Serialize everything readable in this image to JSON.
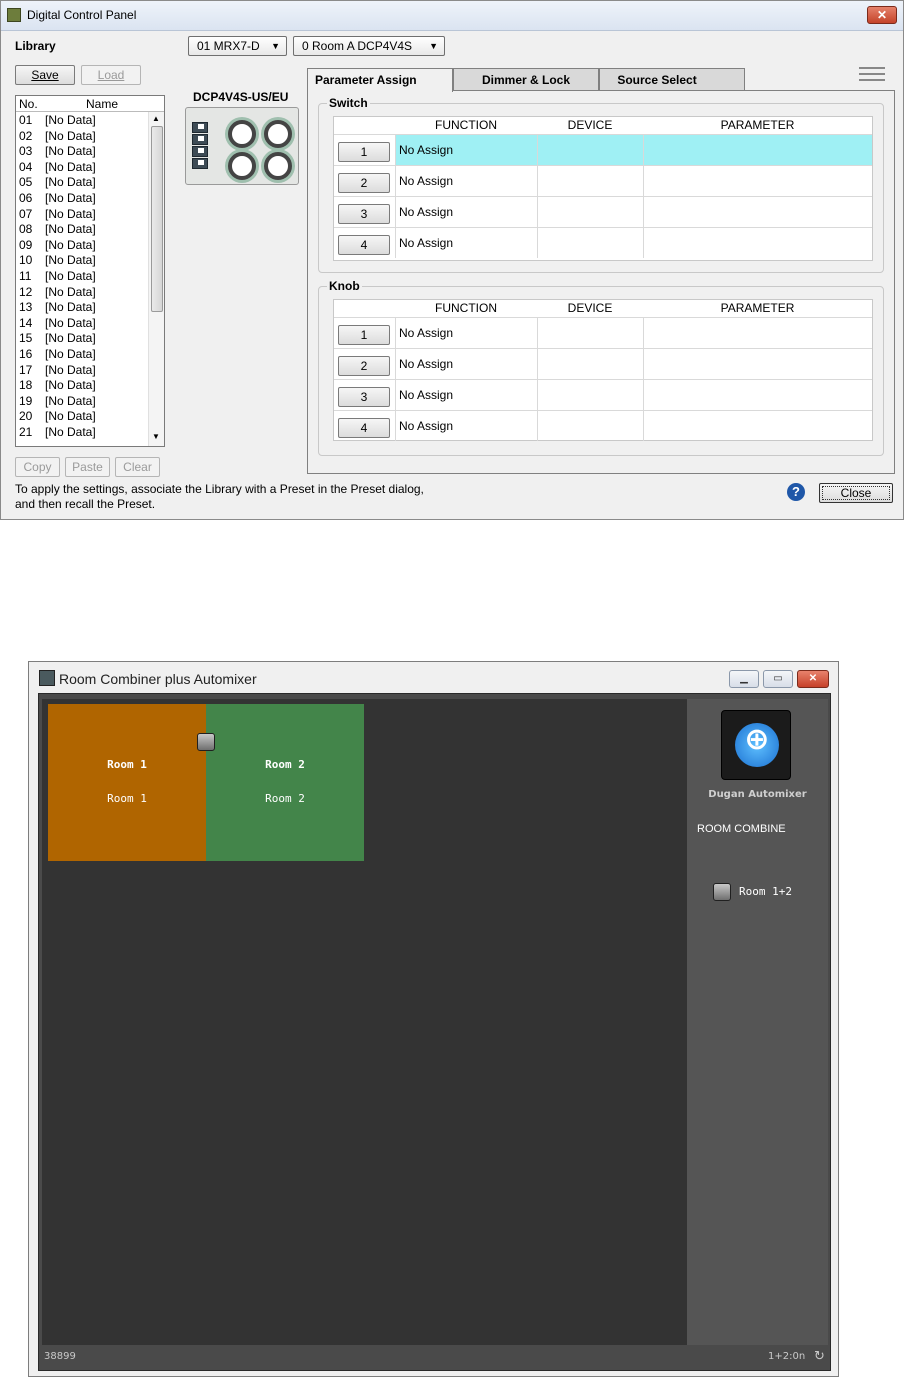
{
  "dcp": {
    "title": "Digital Control Panel",
    "close_glyph": "✕",
    "library_label": "Library",
    "save_label": "Save",
    "load_label": "Load",
    "device_select": "01 MRX7-D",
    "preset_select": "0 Room A DCP4V4S",
    "device_model": "DCP4V4S-US/EU",
    "list_header": {
      "no": "No.",
      "name": "Name"
    },
    "library_items": [
      {
        "no": "01",
        "name": "[No Data]"
      },
      {
        "no": "02",
        "name": "[No Data]"
      },
      {
        "no": "03",
        "name": "[No Data]"
      },
      {
        "no": "04",
        "name": "[No Data]"
      },
      {
        "no": "05",
        "name": "[No Data]"
      },
      {
        "no": "06",
        "name": "[No Data]"
      },
      {
        "no": "07",
        "name": "[No Data]"
      },
      {
        "no": "08",
        "name": "[No Data]"
      },
      {
        "no": "09",
        "name": "[No Data]"
      },
      {
        "no": "10",
        "name": "[No Data]"
      },
      {
        "no": "11",
        "name": "[No Data]"
      },
      {
        "no": "12",
        "name": "[No Data]"
      },
      {
        "no": "13",
        "name": "[No Data]"
      },
      {
        "no": "14",
        "name": "[No Data]"
      },
      {
        "no": "15",
        "name": "[No Data]"
      },
      {
        "no": "16",
        "name": "[No Data]"
      },
      {
        "no": "17",
        "name": "[No Data]"
      },
      {
        "no": "18",
        "name": "[No Data]"
      },
      {
        "no": "19",
        "name": "[No Data]"
      },
      {
        "no": "20",
        "name": "[No Data]"
      },
      {
        "no": "21",
        "name": "[No Data]"
      }
    ],
    "copy_label": "Copy",
    "paste_label": "Paste",
    "clear_label": "Clear",
    "tabs": [
      "Parameter Assign",
      "Dimmer & Lock",
      "Source Select"
    ],
    "switch_group": "Switch",
    "knob_group": "Knob",
    "columns": {
      "function": "FUNCTION",
      "device": "DEVICE",
      "parameter": "PARAMETER"
    },
    "switch_rows": [
      {
        "num": "1",
        "function": "No Assign",
        "device": "",
        "parameter": ""
      },
      {
        "num": "2",
        "function": "No Assign",
        "device": "",
        "parameter": ""
      },
      {
        "num": "3",
        "function": "No Assign",
        "device": "",
        "parameter": ""
      },
      {
        "num": "4",
        "function": "No Assign",
        "device": "",
        "parameter": ""
      }
    ],
    "knob_rows": [
      {
        "num": "1",
        "function": "No Assign",
        "device": "",
        "parameter": ""
      },
      {
        "num": "2",
        "function": "No Assign",
        "device": "",
        "parameter": ""
      },
      {
        "num": "3",
        "function": "No Assign",
        "device": "",
        "parameter": ""
      },
      {
        "num": "4",
        "function": "No Assign",
        "device": "",
        "parameter": ""
      }
    ],
    "footer_line1": "To apply the settings, associate the Library with a Preset in the Preset dialog,",
    "footer_line2": "and then recall the Preset.",
    "help_glyph": "?",
    "close_label": "Close",
    "selection_color": "#9ff0f4"
  },
  "rc": {
    "title": "Room Combiner plus Automixer",
    "rooms": [
      {
        "name": "Room 1",
        "subtitle": "Room 1",
        "color": "#b06500"
      },
      {
        "name": "Room 2",
        "subtitle": "Room 2",
        "color": "#43854a"
      }
    ],
    "dugan_label": "Dugan Automixer",
    "room_combine_label": "ROOM COMBINE",
    "combine_toggle_label": "Room 1+2",
    "status_left": "38899",
    "status_right": "1+2:0n"
  }
}
